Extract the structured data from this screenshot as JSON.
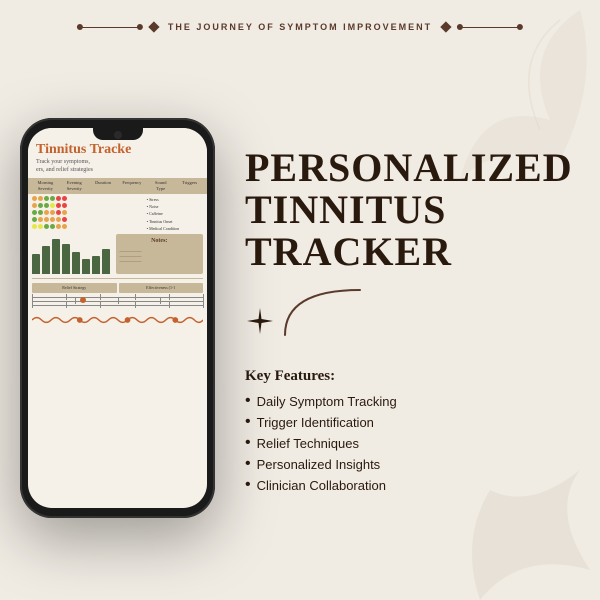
{
  "banner": {
    "text": "THE JOURNEY OF SYMPTOM IMPROVEMENT"
  },
  "phone": {
    "screen_title": "Tinnitus Tracke",
    "screen_subtitle_line1": "Track your symptoms,",
    "screen_subtitle_line2": "ers, and relief strategies",
    "table_headers": [
      "Morning\nSeverity",
      "Evening\nSeverity",
      "Duration",
      "Frequency",
      "Sound\nType",
      "Triggers"
    ],
    "notes_label": "Notes:",
    "relief_label": "Relief Strategy",
    "effectiveness_label": "Effectiveness (1-1"
  },
  "main_title_line1": "PERSONALIZED",
  "main_title_line2": "TINNITUS",
  "main_title_line3": "TRACKER",
  "key_features": {
    "heading": "Key Features:",
    "items": [
      "Daily Symptom Tracking",
      "Trigger Identification",
      "Relief Techniques",
      "Personalized Insights",
      "Clinician Collaboration"
    ]
  },
  "dots_rows": [
    [
      "#e8a44a",
      "#e8a44a",
      "#6aaa44",
      "#6aaa44",
      "#e84444",
      "#e84444"
    ],
    [
      "#e8a44a",
      "#6aaa44",
      "#6aaa44",
      "#e8e844",
      "#e84444",
      "#e84444"
    ],
    [
      "#6aaa44",
      "#6aaa44",
      "#e8a44a",
      "#e8a44a",
      "#e84444",
      "#e8a44a"
    ],
    [
      "#6aaa44",
      "#e8a44a",
      "#e8a44a",
      "#e8a44a",
      "#e8a44a",
      "#e84444"
    ],
    [
      "#e8e844",
      "#e8e844",
      "#6aaa44",
      "#6aaa44",
      "#e8a44a",
      "#e8a44a"
    ]
  ],
  "bars": [
    25,
    32,
    38,
    30,
    20,
    15,
    22,
    28
  ],
  "colors": {
    "brand_dark": "#2a1a0e",
    "brand_medium": "#5a3a2a",
    "brand_orange": "#c4622d",
    "bg": "#f0ebe3",
    "tan": "#c8b89a",
    "green_bar": "#4a6741"
  }
}
